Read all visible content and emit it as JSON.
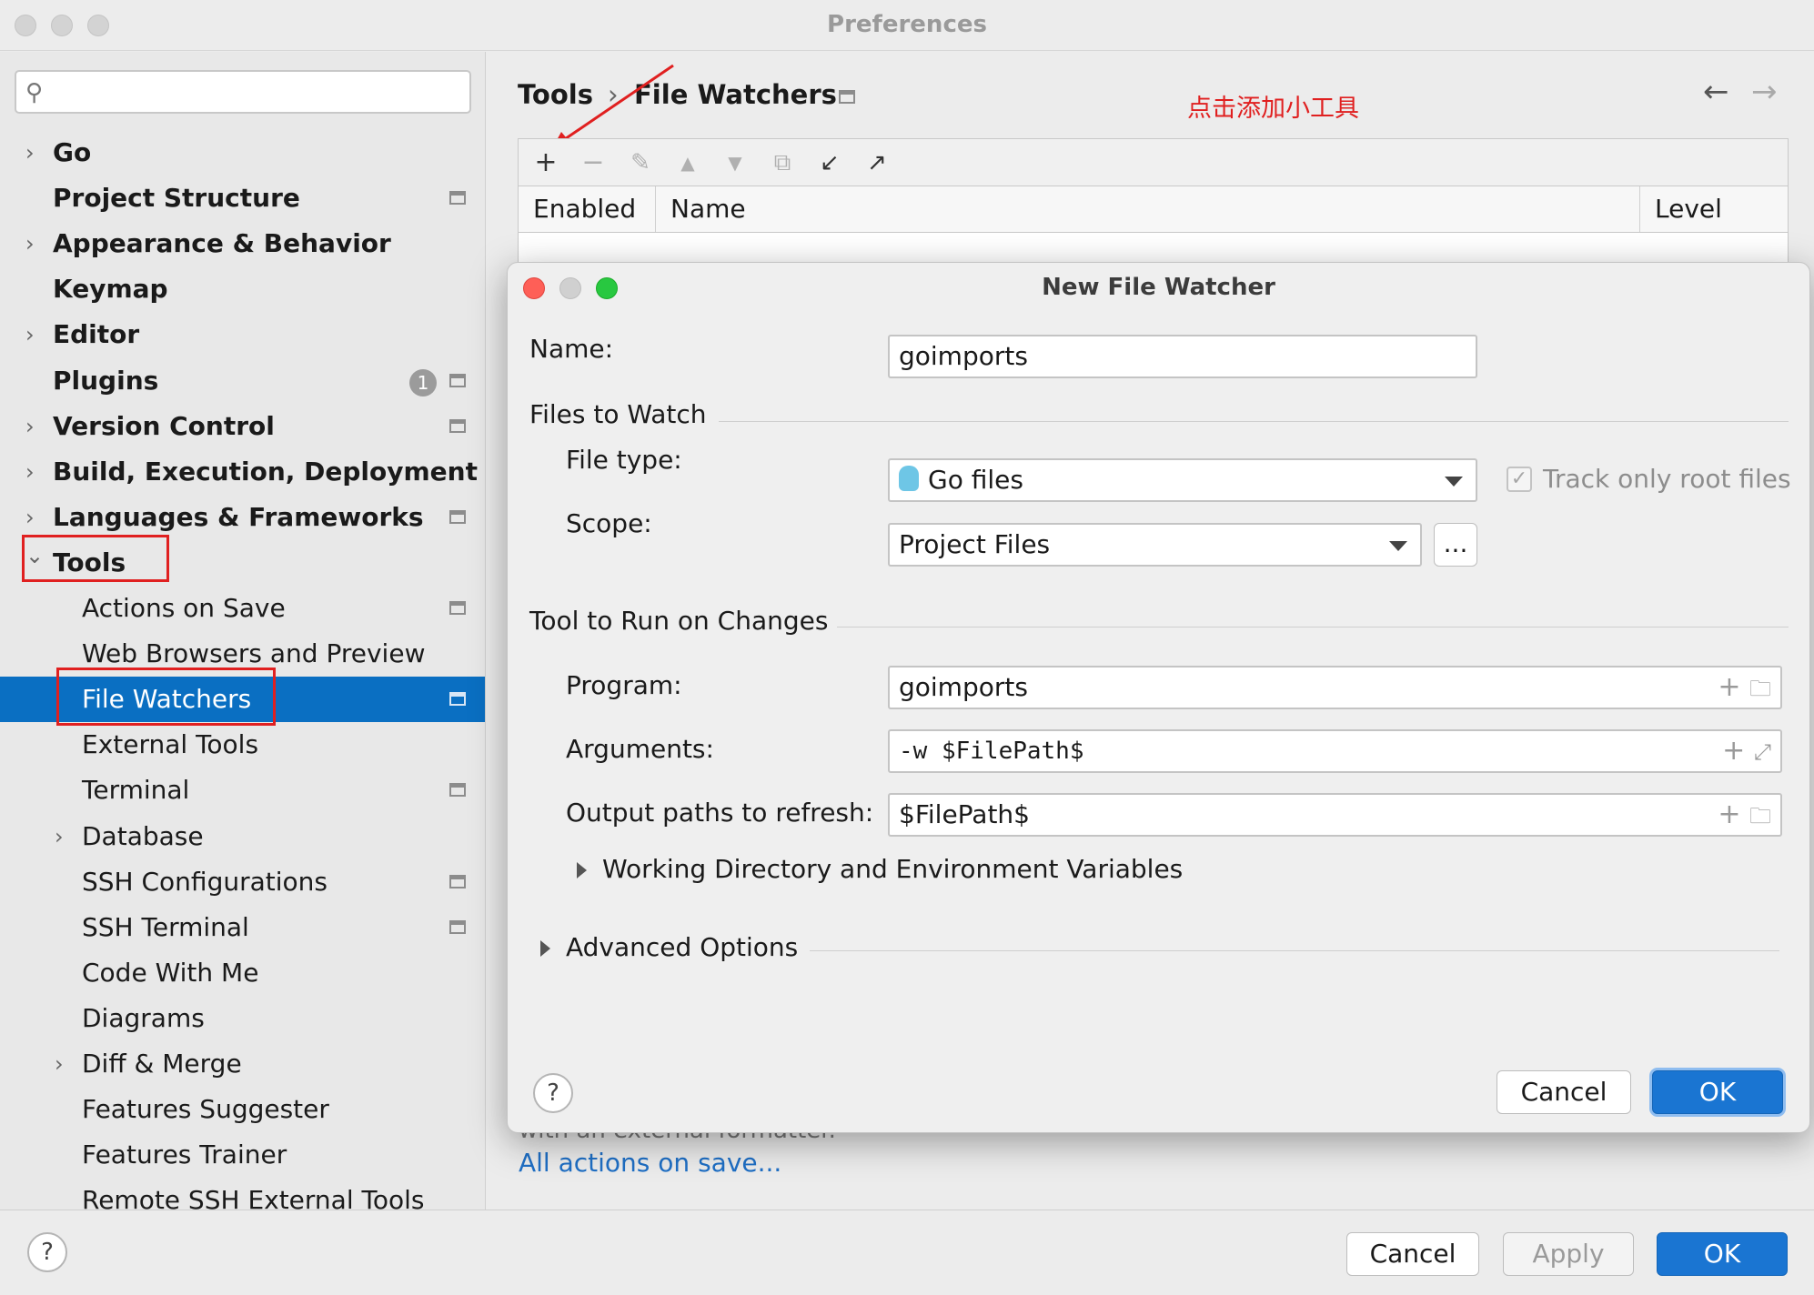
{
  "window": {
    "title": "Preferences"
  },
  "sidebar": {
    "search_placeholder": "",
    "items": [
      {
        "label": "Go",
        "expandable": true,
        "bold": true
      },
      {
        "label": "Project Structure",
        "bold": true,
        "project_icon": true
      },
      {
        "label": "Appearance & Behavior",
        "expandable": true,
        "bold": true
      },
      {
        "label": "Keymap",
        "bold": true
      },
      {
        "label": "Editor",
        "expandable": true,
        "bold": true
      },
      {
        "label": "Plugins",
        "bold": true,
        "badge": "1",
        "project_icon": true
      },
      {
        "label": "Version Control",
        "expandable": true,
        "bold": true,
        "project_icon": true
      },
      {
        "label": "Build, Execution, Deployment",
        "expandable": true,
        "bold": true
      },
      {
        "label": "Languages & Frameworks",
        "expandable": true,
        "bold": true,
        "project_icon": true
      },
      {
        "label": "Tools",
        "expanded": true,
        "bold": true
      },
      {
        "label": "Actions on Save",
        "project_icon": true
      },
      {
        "label": "Web Browsers and Preview"
      },
      {
        "label": "File Watchers",
        "selected": true,
        "project_icon": true
      },
      {
        "label": "External Tools"
      },
      {
        "label": "Terminal",
        "project_icon": true
      },
      {
        "label": "Database",
        "expandable": true
      },
      {
        "label": "SSH Configurations",
        "project_icon": true
      },
      {
        "label": "SSH Terminal",
        "project_icon": true
      },
      {
        "label": "Code With Me"
      },
      {
        "label": "Diagrams"
      },
      {
        "label": "Diff & Merge",
        "expandable": true
      },
      {
        "label": "Features Suggester"
      },
      {
        "label": "Features Trainer"
      },
      {
        "label": "Remote SSH External Tools"
      }
    ]
  },
  "main": {
    "breadcrumb": [
      "Tools",
      "File Watchers"
    ],
    "annotation": "点击添加小工具",
    "table_headers": [
      "Enabled",
      "Name",
      "Level"
    ],
    "hidden_text": "with an external formatter.",
    "link": "All actions on save..."
  },
  "dialog": {
    "title": "New File Watcher",
    "name_label": "Name:",
    "name_value": "goimports",
    "files_section": "Files to Watch",
    "file_type_label": "File type:",
    "file_type_value": "Go files",
    "track_root_label": "Track only root files",
    "track_root_checked": true,
    "scope_label": "Scope:",
    "scope_value": "Project Files",
    "scope_more": "...",
    "tool_section": "Tool to Run on Changes",
    "program_label": "Program:",
    "program_value": "goimports",
    "arguments_label": "Arguments:",
    "arguments_value": "-w $FilePath$",
    "output_label": "Output paths to refresh:",
    "output_value": "$FilePath$",
    "working_dir_label": "Working Directory and Environment Variables",
    "advanced_label": "Advanced Options",
    "help": "?",
    "cancel": "Cancel",
    "ok": "OK"
  },
  "footer": {
    "help": "?",
    "cancel": "Cancel",
    "apply": "Apply",
    "ok": "OK"
  },
  "colors": {
    "accent": "#0a6fc2",
    "annotation_red": "#e02020",
    "link": "#1f6fc5",
    "close_red": "#fe5f57",
    "minimize_gray": "#d0d0d0",
    "zoom_green": "#28c840"
  }
}
